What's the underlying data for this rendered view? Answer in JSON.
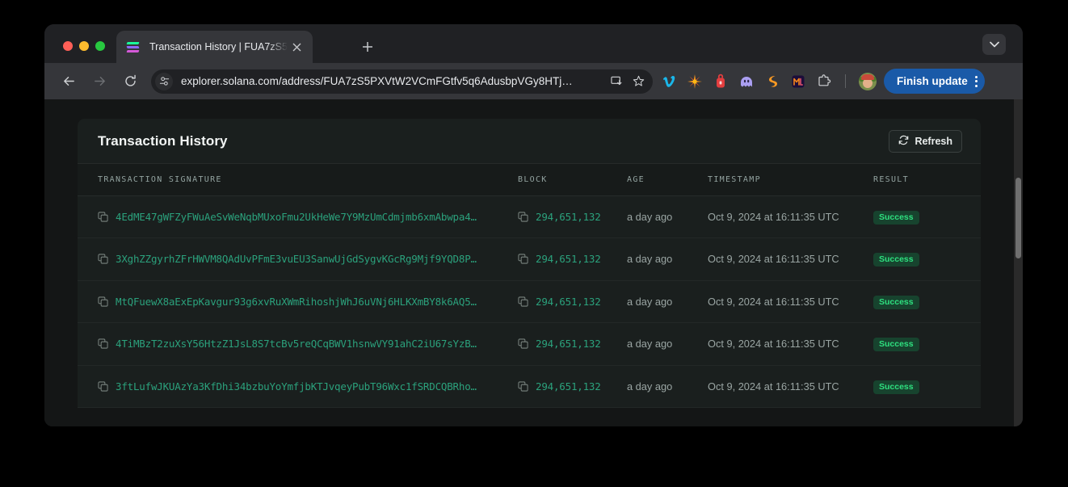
{
  "window": {
    "traffic_lights": [
      "close",
      "minimize",
      "zoom"
    ],
    "tab": {
      "title": "Transaction History | FUA7zS5",
      "favicon": "solana-icon",
      "close_label": "×"
    },
    "new_tab_label": "+",
    "tab_search_label": "⌄"
  },
  "toolbar": {
    "back_label": "←",
    "forward_label": "→",
    "reload_label": "↻",
    "site_settings_icon": "tune-icon",
    "url": "explorer.solana.com/address/FUA7zS5PXVtW2VCmFGtfv5q6AdusbpVGy8HTj…",
    "install_icon": "install-app-icon",
    "bookmark_icon": "star-icon",
    "extensions": [
      {
        "name": "vimeo-extension",
        "glyph": "𝑽",
        "color": "#1ab7ea"
      },
      {
        "name": "sparkle-extension",
        "glyph": "✳",
        "color": "#f58220"
      },
      {
        "name": "backpack-extension",
        "glyph": "▮",
        "color": "#e33e3f"
      },
      {
        "name": "phantom-extension",
        "glyph": "●",
        "color": "#ab9ff2"
      },
      {
        "name": "solflare-extension",
        "glyph": "S",
        "color": "#fc9a23"
      },
      {
        "name": "metamask-extension",
        "glyph": "M",
        "color": "#f6851b"
      },
      {
        "name": "extensions-puzzle-icon",
        "glyph": "⧉",
        "color": "#cfd1d4"
      }
    ],
    "profile_name": "avatar",
    "finish_update_label": "Finish update",
    "menu_icon": "kebab-menu-icon"
  },
  "card": {
    "title": "Transaction History",
    "refresh_label": "Refresh",
    "refresh_icon": "refresh-icon",
    "columns": [
      "TRANSACTION SIGNATURE",
      "BLOCK",
      "AGE",
      "TIMESTAMP",
      "RESULT"
    ],
    "rows": [
      {
        "signature": "4EdME47gWFZyFWuAeSvWeNqbMUxoFmu2UkHeWe7Y9MzUmCdmjmb6xmAbwpa4…",
        "block": "294,651,132",
        "age": "a day ago",
        "timestamp": "Oct 9, 2024 at 16:11:35 UTC",
        "result": "Success"
      },
      {
        "signature": "3XghZZgyrhZFrHWVM8QAdUvPFmE3vuEU3SanwUjGdSygvKGcRg9Mjf9YQD8P…",
        "block": "294,651,132",
        "age": "a day ago",
        "timestamp": "Oct 9, 2024 at 16:11:35 UTC",
        "result": "Success"
      },
      {
        "signature": "MtQFuewX8aExEpKavgur93g6xvRuXWmRihoshjWhJ6uVNj6HLKXmBY8k6AQ5…",
        "block": "294,651,132",
        "age": "a day ago",
        "timestamp": "Oct 9, 2024 at 16:11:35 UTC",
        "result": "Success"
      },
      {
        "signature": "4TiMBzT2zuXsY56HtzZ1JsL8S7tcBv5reQCqBWV1hsnwVY91ahC2iU67sYzB…",
        "block": "294,651,132",
        "age": "a day ago",
        "timestamp": "Oct 9, 2024 at 16:11:35 UTC",
        "result": "Success"
      },
      {
        "signature": "3ftLufwJKUAzYa3KfDhi34bzbuYoYmfjbKTJvqeyPubT96Wxc1fSRDCQBRho…",
        "block": "294,651,132",
        "age": "a day ago",
        "timestamp": "Oct 9, 2024 at 16:11:35 UTC",
        "result": "Success"
      }
    ]
  },
  "colors": {
    "link_green": "#2ba17c",
    "badge_bg": "#17432e",
    "badge_text": "#2ee07f",
    "update_button": "#1a5aa8",
    "page_bg": "#141616",
    "card_bg": "#1a1f1e"
  }
}
